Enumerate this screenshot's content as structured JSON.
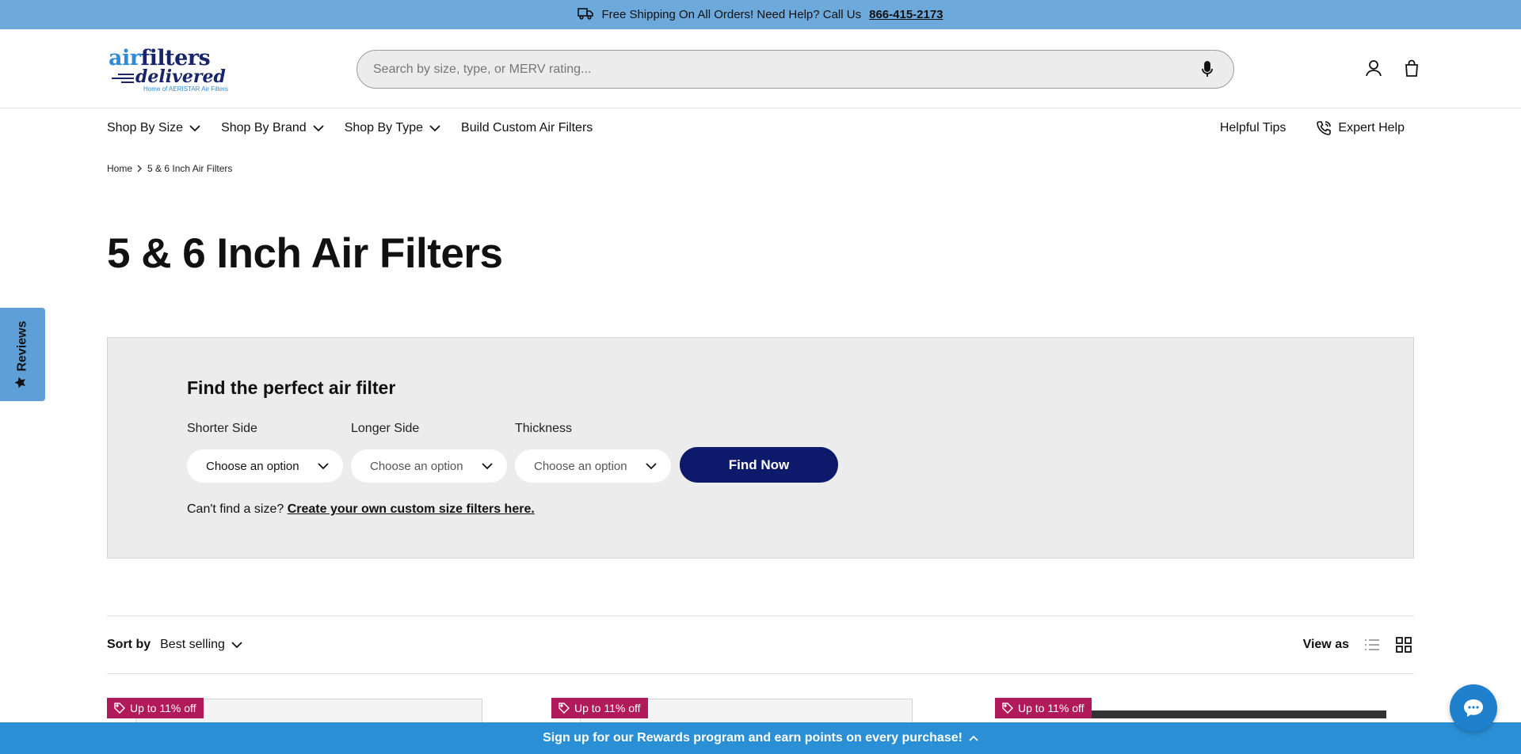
{
  "announcement": {
    "text": "Free Shipping On All Orders! Need Help? Call Us",
    "phone": "866-415-2173",
    "icon": "truck-icon"
  },
  "header": {
    "logo": {
      "line1_air": "air",
      "line1_filters": "filters",
      "line2": "delivered",
      "tagline": "Home of AERISTAR Air Filters"
    },
    "search_placeholder": "Search by size, type, or MERV rating...",
    "icons": [
      "microphone-icon",
      "account-icon",
      "cart-icon"
    ]
  },
  "nav": {
    "items": [
      "Shop By Size",
      "Shop By Brand",
      "Shop By Type",
      "Build Custom Air Filters"
    ],
    "right_items": [
      "Helpful Tips",
      "Expert Help"
    ]
  },
  "breadcrumb": {
    "home": "Home",
    "current": "5 & 6 Inch Air Filters"
  },
  "page_title": "5 & 6 Inch Air Filters",
  "finder": {
    "heading": "Find the perfect air filter",
    "labels": [
      "Shorter Side",
      "Longer Side",
      "Thickness"
    ],
    "selects": [
      "Choose an option",
      "Choose an option",
      "Choose an option"
    ],
    "button": "Find Now",
    "custom_prefix": "Can't find a size?",
    "custom_link": "Create your own custom size filters here."
  },
  "sort": {
    "label": "Sort by",
    "value": "Best selling",
    "view_label": "View as"
  },
  "products": [
    {
      "badge": "Up to 11% off"
    },
    {
      "badge": "Up to 11% off"
    },
    {
      "badge": "Up to 11% off"
    }
  ],
  "reviews_tab": "Reviews",
  "rewards_bar": "Sign up for our Rewards program and earn points on every purchase!",
  "colors": {
    "announcement_bg": "#6ea9dc",
    "brand_navy": "#0d1a6b",
    "brand_blue": "#2b8fd6",
    "badge": "#b0195a"
  }
}
